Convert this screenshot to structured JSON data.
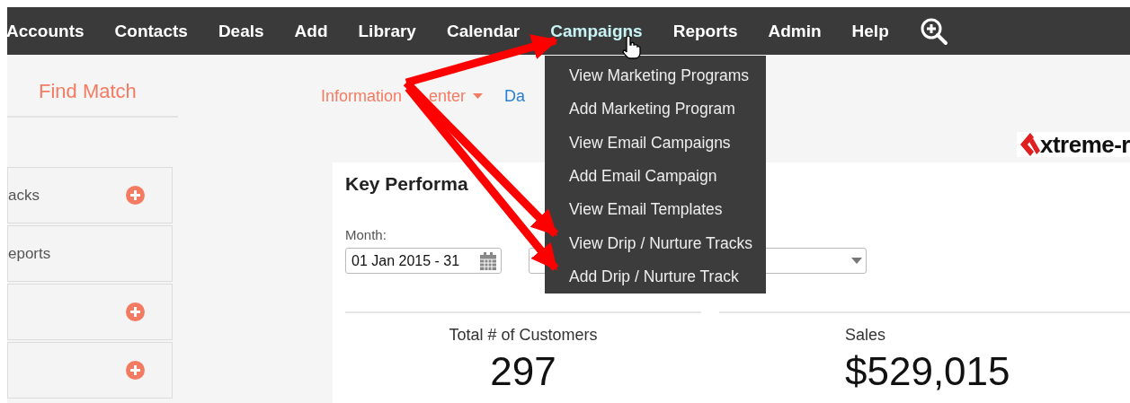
{
  "nav": {
    "items": [
      {
        "label": "Accounts",
        "selected": false
      },
      {
        "label": "Contacts",
        "selected": false
      },
      {
        "label": "Deals",
        "selected": false
      },
      {
        "label": "Add",
        "selected": false
      },
      {
        "label": "Library",
        "selected": false
      },
      {
        "label": "Calendar",
        "selected": false
      },
      {
        "label": "Campaigns",
        "selected": true
      },
      {
        "label": "Reports",
        "selected": false
      },
      {
        "label": "Admin",
        "selected": false
      },
      {
        "label": "Help",
        "selected": false
      }
    ]
  },
  "campaigns_menu": {
    "items": [
      "View Marketing Programs",
      "Add Marketing Program",
      "View Email Campaigns",
      "Add Email Campaign",
      "View Email Templates",
      "View Drip / Nurture Tracks",
      "Add Drip / Nurture Track"
    ]
  },
  "sidebar": {
    "title": "Find Match",
    "items": [
      {
        "label": "acks",
        "kind": "add"
      },
      {
        "label": "eports",
        "kind": "plain"
      },
      {
        "kind": "add"
      },
      {
        "kind": "add"
      }
    ]
  },
  "subnav": [
    {
      "label": "Information",
      "covered_tail": "enter",
      "kind": "dropdown"
    },
    {
      "label": "Da",
      "kind": "link"
    }
  ],
  "logo": {
    "text": "xtreme-r"
  },
  "kpi": {
    "title": "Key Performa",
    "month_label": "Month:",
    "month_value": "01 Jan 2015 - 31",
    "metrics": [
      {
        "label": "Total # of Customers",
        "value": "297"
      },
      {
        "label": "Sales",
        "value": "$529,015"
      }
    ]
  }
}
